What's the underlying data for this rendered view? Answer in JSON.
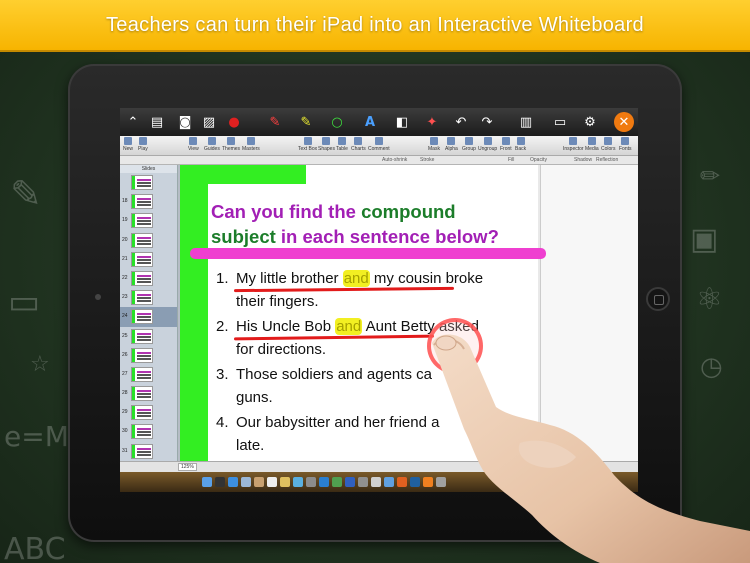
{
  "banner": {
    "text": "Teachers can turn their iPad into an Interactive Whiteboard"
  },
  "toolbar": {
    "icons": [
      "collapse-icon",
      "new-page-icon",
      "camera-icon",
      "image-icon",
      "record-icon",
      "red-pen-icon",
      "highlighter-icon",
      "circle-icon",
      "text-icon",
      "eraser-icon",
      "laser-icon",
      "undo-icon",
      "redo-icon",
      "book-icon",
      "present-icon",
      "settings-icon",
      "close-icon"
    ],
    "record_label": "REC"
  },
  "ribbon": {
    "items": [
      "New",
      "Play",
      "View",
      "Guides",
      "Themes",
      "Masters",
      "Text Box",
      "Shapes",
      "Table",
      "Charts",
      "Comment",
      "Mask",
      "Alpha",
      "Group",
      "Ungroup",
      "Front",
      "Back",
      "Inspector",
      "Media",
      "Colors",
      "Fonts"
    ]
  },
  "formatbar": {
    "auto_shrink": "Auto-shrink",
    "stroke": "Stroke",
    "fill": "Fill",
    "opacity": "Opacity",
    "shadow": "Shadow",
    "reflection": "Reflection"
  },
  "slides_panel": {
    "header": "Slides",
    "numbers": [
      "",
      "18",
      "19",
      "20",
      "21",
      "22",
      "23",
      "24",
      "25",
      "26",
      "27",
      "28",
      "29",
      "30",
      "31"
    ],
    "selected": "24"
  },
  "statusbar": {
    "zoom": "125%"
  },
  "slide": {
    "title_a": "Can you find the ",
    "title_b": "compound",
    "title_c": "subject",
    "title_d": " in each sentence below?",
    "items": [
      {
        "num": "1.",
        "pre": "My little brother ",
        "hl": "and",
        "post": " my cousin broke",
        "line2": "their fingers."
      },
      {
        "num": "2.",
        "pre": "His Uncle Bob ",
        "hl": "and",
        "post": " Aunt Betty asked",
        "line2": "for directions."
      },
      {
        "num": "3.",
        "text": "Those soldiers and agents ca",
        "line2": "guns."
      },
      {
        "num": "4.",
        "text": "Our babysitter and her friend a",
        "line2": "late."
      }
    ]
  },
  "colors": {
    "banner": "#f7b400",
    "slide_green": "#33ee22",
    "title_purple": "#a21fb5",
    "title_green": "#1c7d2a",
    "underline_red": "#e21b1b",
    "highlight_yellow": "#f2ef22"
  }
}
